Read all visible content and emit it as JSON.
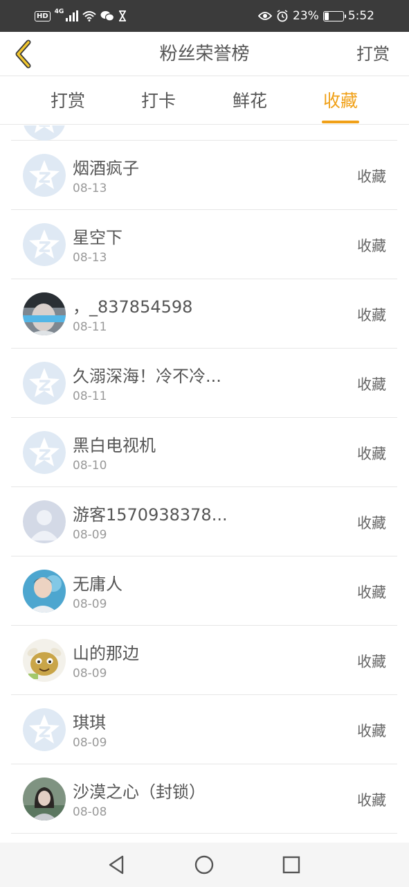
{
  "status_bar": {
    "hd_badge": "HD",
    "network": "4G",
    "battery_text": "23%",
    "battery_level": 0.23,
    "time": "5:52"
  },
  "header": {
    "back_icon": "chevron-left-icon",
    "title": "粉丝荣誉榜",
    "action_label": "打赏"
  },
  "tabs": [
    {
      "label": "打赏",
      "active": false
    },
    {
      "label": "打卡",
      "active": false
    },
    {
      "label": "鲜花",
      "active": false
    },
    {
      "label": "收藏",
      "active": true
    }
  ],
  "list": {
    "items": [
      {
        "name": "烟酒疯子",
        "date": "08-13",
        "action": "收藏",
        "avatar": "default-star-avatar"
      },
      {
        "name": "星空下",
        "date": "08-13",
        "action": "收藏",
        "avatar": "default-star-avatar"
      },
      {
        "name": "，_837854598",
        "date": "08-11",
        "action": "收藏",
        "avatar": "photo-avatar-masked"
      },
      {
        "name": "久溺深海！冷不冷...",
        "date": "08-11",
        "action": "收藏",
        "avatar": "default-star-avatar"
      },
      {
        "name": "黑白电视机",
        "date": "08-10",
        "action": "收藏",
        "avatar": "default-star-avatar"
      },
      {
        "name": "游客1570938378...",
        "date": "08-09",
        "action": "收藏",
        "avatar": "guest-silhouette-avatar"
      },
      {
        "name": "无庸人",
        "date": "08-09",
        "action": "收藏",
        "avatar": "photo-avatar-man"
      },
      {
        "name": "山的那边",
        "date": "08-09",
        "action": "收藏",
        "avatar": "cartoon-avatar"
      },
      {
        "name": "琪琪",
        "date": "08-09",
        "action": "收藏",
        "avatar": "default-star-avatar"
      },
      {
        "name": "沙漠之心（封锁）",
        "date": "08-08",
        "action": "收藏",
        "avatar": "photo-avatar-woman"
      }
    ]
  },
  "nav_bar": {
    "back": "triangle-back-icon",
    "home": "circle-home-icon",
    "recents": "square-recents-icon"
  },
  "colors": {
    "accent": "#f0a017",
    "status_bar_bg": "#3b3b3b",
    "divider": "#e6e6e6"
  }
}
